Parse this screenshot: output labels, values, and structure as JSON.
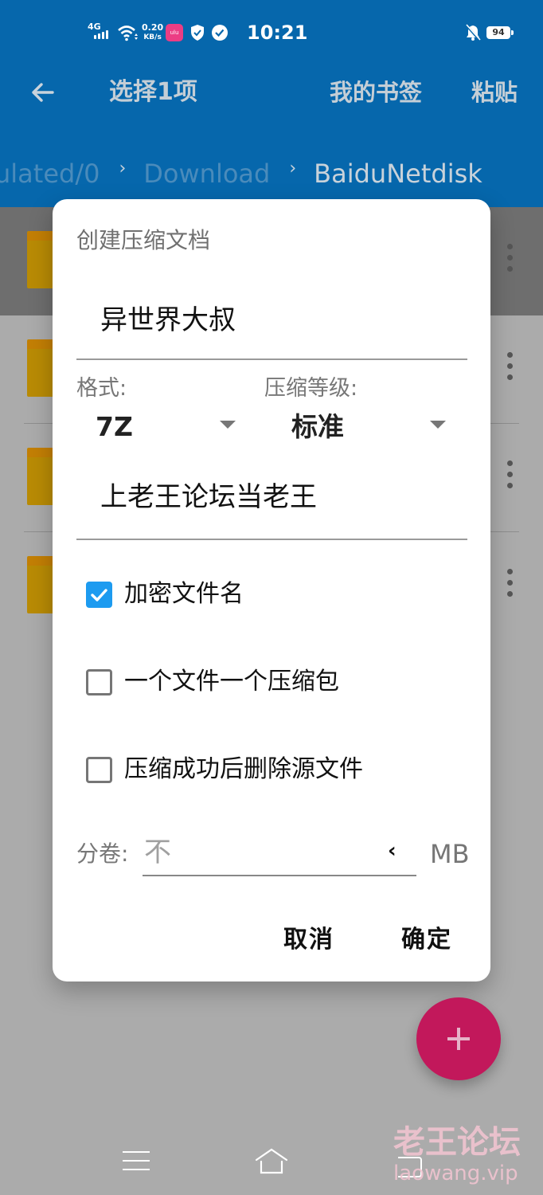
{
  "status_bar": {
    "network": "4G",
    "speed_value": "0.20",
    "speed_unit": "KB/s",
    "app_badge": "ulu",
    "time": "10:21",
    "battery": "94",
    "icons": [
      "signal-icon",
      "wifi-icon",
      "app-icon",
      "shield-icon",
      "check-circle-icon",
      "bell-muted-icon",
      "battery-icon"
    ]
  },
  "toolbar": {
    "back_icon": "arrow-left-icon",
    "title": "选择1项",
    "bookmarks": "我的书签",
    "paste": "粘贴"
  },
  "breadcrumb": {
    "items": [
      "ulated/0",
      "Download",
      "BaiduNetdisk"
    ],
    "separator": "›"
  },
  "file_list": {
    "rows": 4,
    "selected_index": 0
  },
  "dialog": {
    "title": "创建压缩文档",
    "archive_name": "异世界大叔",
    "format_label": "格式:",
    "format_value": "7Z",
    "level_label": "压缩等级:",
    "level_value": "标准",
    "password": "上老王论坛当老王",
    "options": [
      {
        "label": "加密文件名",
        "checked": true
      },
      {
        "label": "一个文件一个压缩包",
        "checked": false
      },
      {
        "label": "压缩成功后删除源文件",
        "checked": false
      }
    ],
    "split_label": "分卷:",
    "split_placeholder": "不",
    "split_chevron": "‹",
    "split_unit": "MB",
    "cancel": "取消",
    "ok": "确定"
  },
  "fab": {
    "icon": "plus-icon",
    "color": "#c2185b"
  },
  "nav": {
    "icons": [
      "menu-icon",
      "home-icon",
      "back-icon"
    ]
  },
  "watermark": {
    "title": "老王论坛",
    "url": "laowang.vip"
  },
  "colors": {
    "appbar": "#0667ac",
    "accent_checkbox": "#1d9bf0",
    "folder": "#b98b05"
  }
}
